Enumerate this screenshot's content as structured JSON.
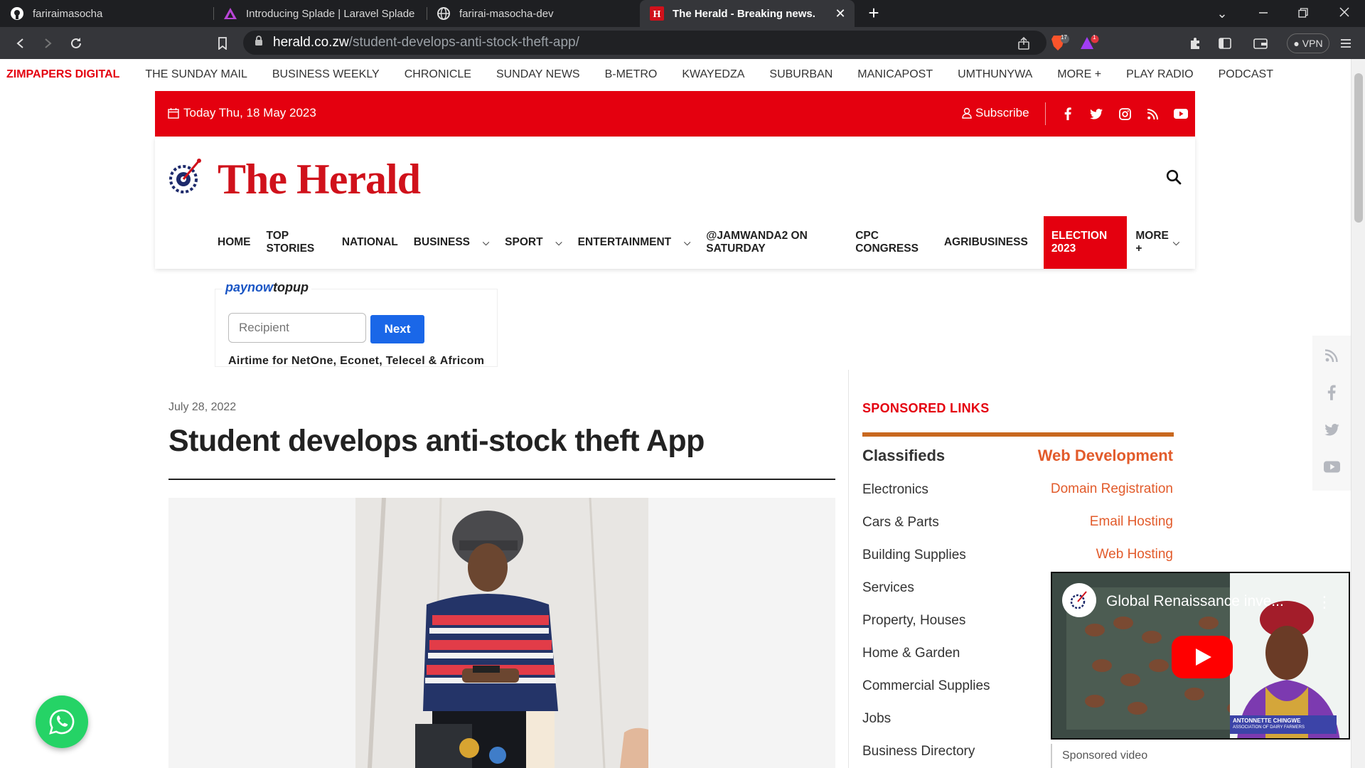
{
  "browser": {
    "tabs": [
      {
        "title": "fariraimasocha",
        "icon": "github-icon"
      },
      {
        "title": "Introducing Splade | Laravel Splade",
        "icon": "splade-icon"
      },
      {
        "title": "farirai-masocha-dev",
        "icon": "globe-icon"
      },
      {
        "title": "The Herald - Breaking news.",
        "icon": "herald-favicon",
        "active": true
      }
    ],
    "url_host": "herald.co.zw",
    "url_path": "/student-develops-anti-stock-theft-app/",
    "brave_badge": "17",
    "rewards_badge": "1",
    "vpn_label": "VPN"
  },
  "network_bar": {
    "brand": "ZIMPAPERS DIGITAL",
    "links": [
      "THE SUNDAY MAIL",
      "BUSINESS WEEKLY",
      "CHRONICLE",
      "SUNDAY NEWS",
      "B-METRO",
      "KWAYEDZA",
      "SUBURBAN",
      "MANICAPOST",
      "UMTHUNYWA",
      "MORE +",
      "PLAY RADIO",
      "PODCAST"
    ]
  },
  "topbar": {
    "date": "Today Thu, 18 May 2023",
    "subscribe": "Subscribe",
    "socials": [
      "facebook-icon",
      "twitter-icon",
      "instagram-icon",
      "rss-icon",
      "youtube-icon"
    ]
  },
  "header": {
    "logo_text": "The Herald",
    "nav": [
      {
        "label": "HOME"
      },
      {
        "label": "TOP STORIES"
      },
      {
        "label": "NATIONAL"
      },
      {
        "label": "BUSINESS",
        "dropdown": true
      },
      {
        "label": "SPORT",
        "dropdown": true
      },
      {
        "label": "ENTERTAINMENT",
        "dropdown": true
      },
      {
        "label": "@JAMWANDA2 ON SATURDAY"
      },
      {
        "label": "CPC CONGRESS"
      },
      {
        "label": "AGRIBUSINESS"
      },
      {
        "label": "ELECTION 2023",
        "highlight": true
      },
      {
        "label": "MORE +",
        "dropdown": true
      }
    ]
  },
  "paynow": {
    "brand_a": "paynow",
    "brand_b": "topup",
    "placeholder": "Recipient",
    "button": "Next",
    "note": "Airtime for NetOne, Econet, Telecel & Africom"
  },
  "article": {
    "date": "July 28, 2022",
    "title": "Student develops anti-stock theft App"
  },
  "sponsored": {
    "title": "SPONSORED LINKS",
    "classifieds_heading": "Classifieds",
    "classifieds": [
      "Electronics",
      "Cars & Parts",
      "Building Supplies",
      "Services",
      "Property, Houses",
      "Home & Garden",
      "Commercial Supplies",
      "Jobs",
      "Business Directory"
    ],
    "webdev_heading": "Web Development",
    "webdev": [
      "Domain Registration",
      "Email Hosting",
      "Web Hosting"
    ]
  },
  "video": {
    "title": "Global Renaissance inve...",
    "caption_name": "ANTONNETTE CHINGWE",
    "caption_org": "ASSOCIATION OF DAIRY FARMERS",
    "sponsored_label": "Sponsored video"
  },
  "colors": {
    "brand_red": "#e4000f",
    "accent_orange": "#e25b2b",
    "paynow_blue": "#1a67e8",
    "whatsapp_green": "#25d366"
  }
}
